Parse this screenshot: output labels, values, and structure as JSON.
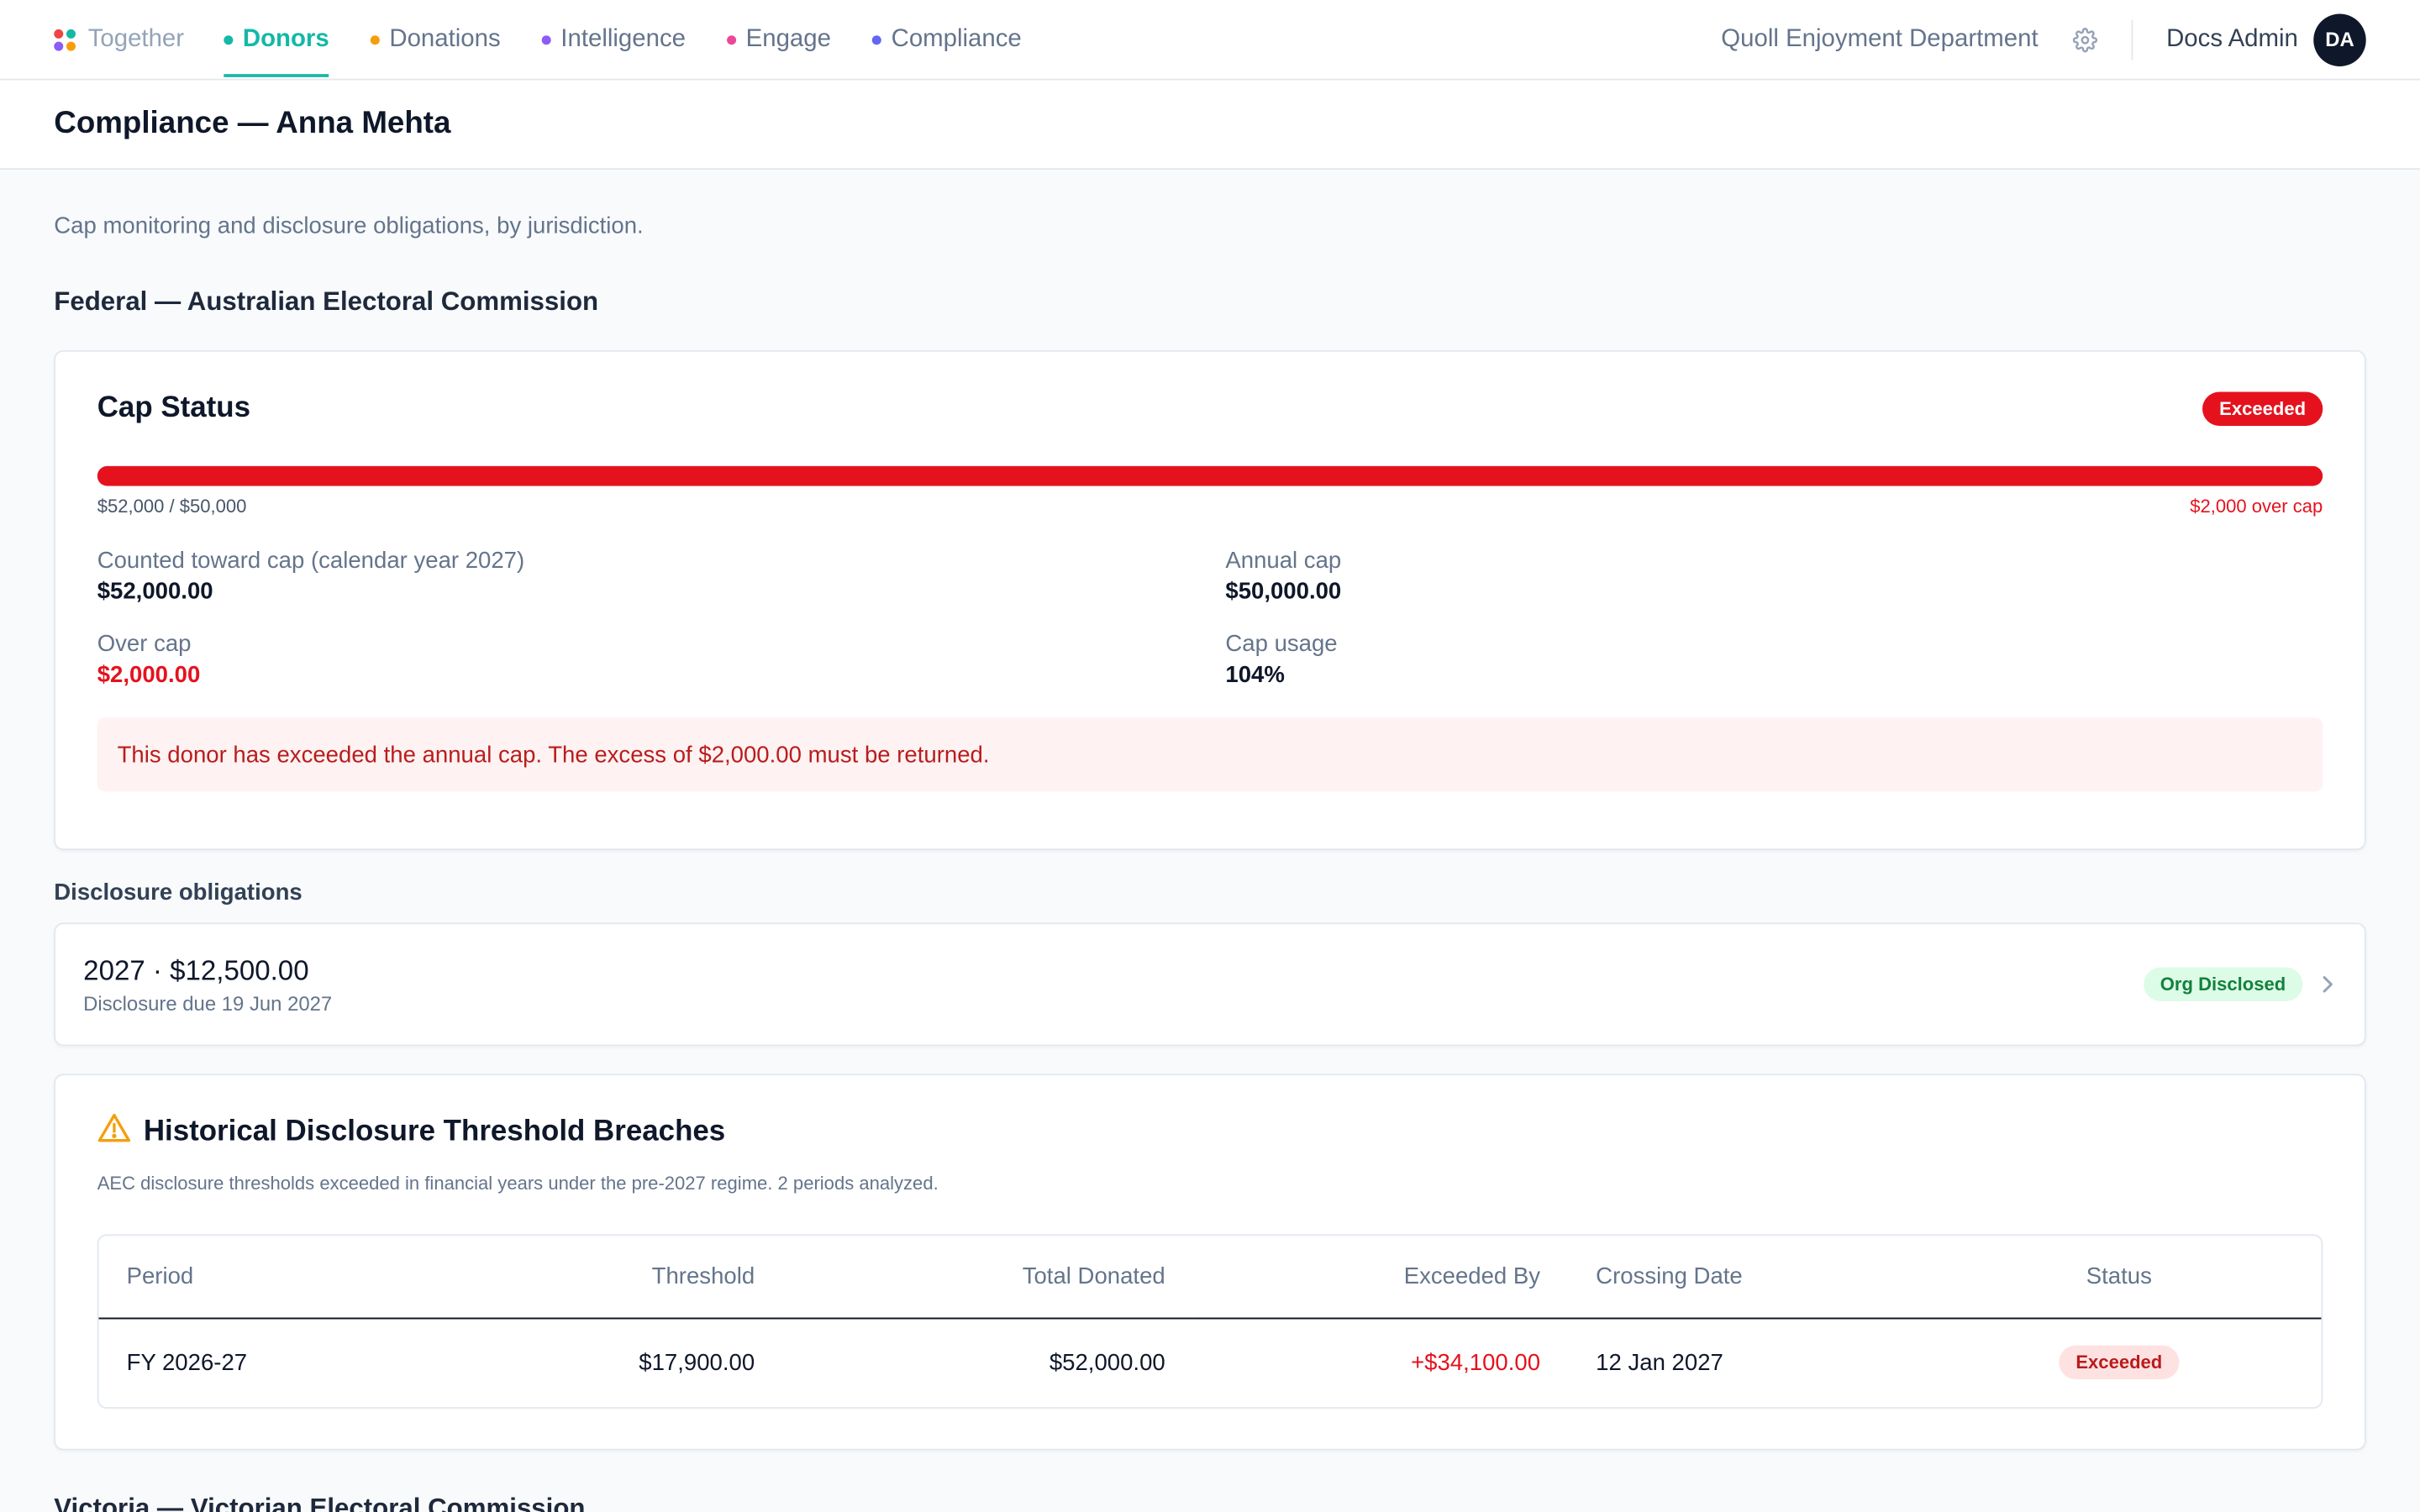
{
  "nav": {
    "brand": "Together",
    "brand_dot_colors": [
      "#ef4444",
      "#14b8a6",
      "#8b5cf6",
      "#f59e0b"
    ],
    "items": [
      {
        "label": "Donors",
        "color": "#14b8a6",
        "active": true
      },
      {
        "label": "Donations",
        "color": "#f59e0b",
        "active": false
      },
      {
        "label": "Intelligence",
        "color": "#8b5cf6",
        "active": false
      },
      {
        "label": "Engage",
        "color": "#ec4899",
        "active": false
      },
      {
        "label": "Compliance",
        "color": "#6366f1",
        "active": false
      }
    ],
    "org_name": "Quoll Enjoyment Department",
    "settings_icon": "gear-icon",
    "user_name": "Docs Admin",
    "user_initials": "DA"
  },
  "page": {
    "title": "Compliance — Anna Mehta",
    "subtitle": "Cap monitoring and disclosure obligations, by jurisdiction."
  },
  "federal": {
    "section_title": "Federal — Australian Electoral Commission",
    "cap_status": {
      "title": "Cap Status",
      "badge": "Exceeded",
      "progress_fraction": 1.0,
      "bar_left": "$52,000 / $50,000",
      "bar_right": "$2,000 over cap",
      "stats": {
        "counted_label": "Counted toward cap (calendar year 2027)",
        "counted_value": "$52,000.00",
        "annual_cap_label": "Annual cap",
        "annual_cap_value": "$50,000.00",
        "over_cap_label": "Over cap",
        "over_cap_value": "$2,000.00",
        "cap_usage_label": "Cap usage",
        "cap_usage_value": "104%"
      },
      "alert": "This donor has exceeded the annual cap. The excess of $2,000.00 must be returned."
    },
    "disclosure": {
      "heading": "Disclosure obligations",
      "items": [
        {
          "title": "2027 · $12,500.00",
          "subtitle": "Disclosure due 19 Jun 2027",
          "badge": "Org Disclosed"
        }
      ]
    },
    "historical": {
      "title": "Historical Disclosure Threshold Breaches",
      "icon": "warning-icon",
      "subtitle": "AEC disclosure thresholds exceeded in financial years under the pre-2027 regime. 2 periods analyzed.",
      "columns": [
        "Period",
        "Threshold",
        "Total Donated",
        "Exceeded By",
        "Crossing Date",
        "Status"
      ],
      "rows": [
        {
          "period": "FY 2026-27",
          "threshold": "$17,900.00",
          "total": "$52,000.00",
          "exceeded_by": "+$34,100.00",
          "crossing_date": "12 Jan 2027",
          "status": "Exceeded"
        }
      ]
    }
  },
  "victoria": {
    "section_title": "Victoria — Victorian Electoral Commission"
  }
}
